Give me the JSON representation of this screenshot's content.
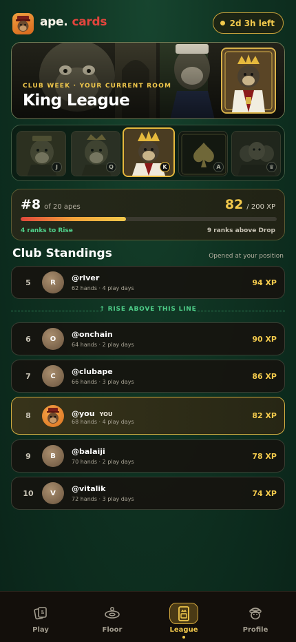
{
  "brand": {
    "name": "ape.",
    "suffix": "cards"
  },
  "timer": {
    "label": "2d 3h left"
  },
  "hero": {
    "eyebrow": "CLUB WEEK · YOUR CURRENT ROOM",
    "title": "King League"
  },
  "rooms": [
    {
      "badge": "J",
      "state": "passed"
    },
    {
      "badge": "Q",
      "state": "passed"
    },
    {
      "badge": "K",
      "state": "current"
    },
    {
      "badge": "A",
      "state": "locked"
    },
    {
      "badge": "♛",
      "state": "locked"
    }
  ],
  "rank": {
    "position": "#8",
    "of": "of 20 apes",
    "xp": "82",
    "xp_total": "/ 200 XP",
    "progress": 0.41,
    "to_rise": "4 ranks to Rise",
    "above_drop": "9 ranks above Drop"
  },
  "standings": {
    "title": "Club Standings",
    "note": "Opened at your position",
    "rise_line": "↑ RISE ABOVE THIS LINE",
    "rows": [
      {
        "pos": "5",
        "initial": "R",
        "name": "@river",
        "meta": "62 hands · 4 play days",
        "xp": "94 XP"
      },
      {
        "pos": "6",
        "initial": "O",
        "name": "@onchain",
        "meta": "64 hands · 2 play days",
        "xp": "90 XP"
      },
      {
        "pos": "7",
        "initial": "C",
        "name": "@clubape",
        "meta": "66 hands · 3 play days",
        "xp": "86 XP"
      },
      {
        "pos": "8",
        "initial": "",
        "name": "@you",
        "you": "YOU",
        "meta": "68 hands · 4 play days",
        "xp": "82 XP"
      },
      {
        "pos": "9",
        "initial": "B",
        "name": "@balaiji",
        "meta": "70 hands · 2 play days",
        "xp": "78 XP"
      },
      {
        "pos": "10",
        "initial": "V",
        "name": "@vitalik",
        "meta": "72 hands · 3 play days",
        "xp": "74 XP"
      }
    ]
  },
  "nav": [
    {
      "label": "Play",
      "icon": "cards-icon"
    },
    {
      "label": "Floor",
      "icon": "poker-table-icon"
    },
    {
      "label": "League",
      "icon": "league-card-icon",
      "active": true
    },
    {
      "label": "Profile",
      "icon": "ape-profile-icon"
    }
  ],
  "colors": {
    "accent": "#f2c94c",
    "brand_red": "#e2453d",
    "rise_green": "#4fd08a",
    "background": "#0f3322"
  }
}
